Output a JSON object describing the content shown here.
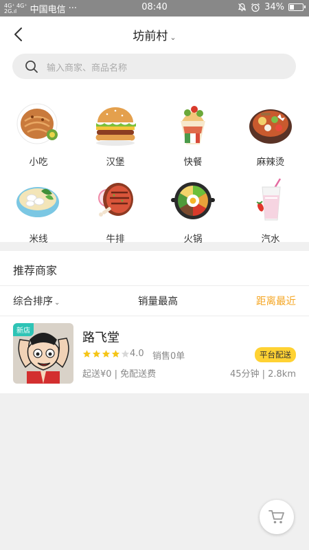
{
  "status_bar": {
    "signal_top": "4G⁺ 4G⁺",
    "signal_bottom": "2G.ıl",
    "carrier": "中国电信",
    "dots": "···",
    "time": "08:40",
    "battery": "34%",
    "battery_level": 0.34
  },
  "header": {
    "title": "坊前村",
    "title_chevron": "⌄"
  },
  "search": {
    "placeholder": "输入商家、商品名称"
  },
  "categories": [
    {
      "label": "小吃",
      "icon": "pancake-icon"
    },
    {
      "label": "汉堡",
      "icon": "burger-icon"
    },
    {
      "label": "快餐",
      "icon": "wrap-icon"
    },
    {
      "label": "麻辣烫",
      "icon": "hotpot-bowl-icon"
    },
    {
      "label": "米线",
      "icon": "noodle-bowl-icon"
    },
    {
      "label": "牛排",
      "icon": "steak-icon"
    },
    {
      "label": "火锅",
      "icon": "bibimbap-pot-icon"
    },
    {
      "label": "汽水",
      "icon": "milkshake-icon"
    }
  ],
  "recommend": {
    "title": "推荐商家",
    "sort": {
      "default": "综合排序",
      "default_chevron": "⌄",
      "sales": "销量最高",
      "distance": "距离最近"
    },
    "active_color": "#f5a623"
  },
  "shops": [
    {
      "new_badge": "新店",
      "name": "路飞堂",
      "stars": 4,
      "stars_total": 5,
      "rating": "4.0",
      "sales": "销售0单",
      "delivery_badge": "平台配送",
      "fees": "起送¥0 | 免配送费",
      "distance": "45分钟 | 2.8km"
    }
  ]
}
